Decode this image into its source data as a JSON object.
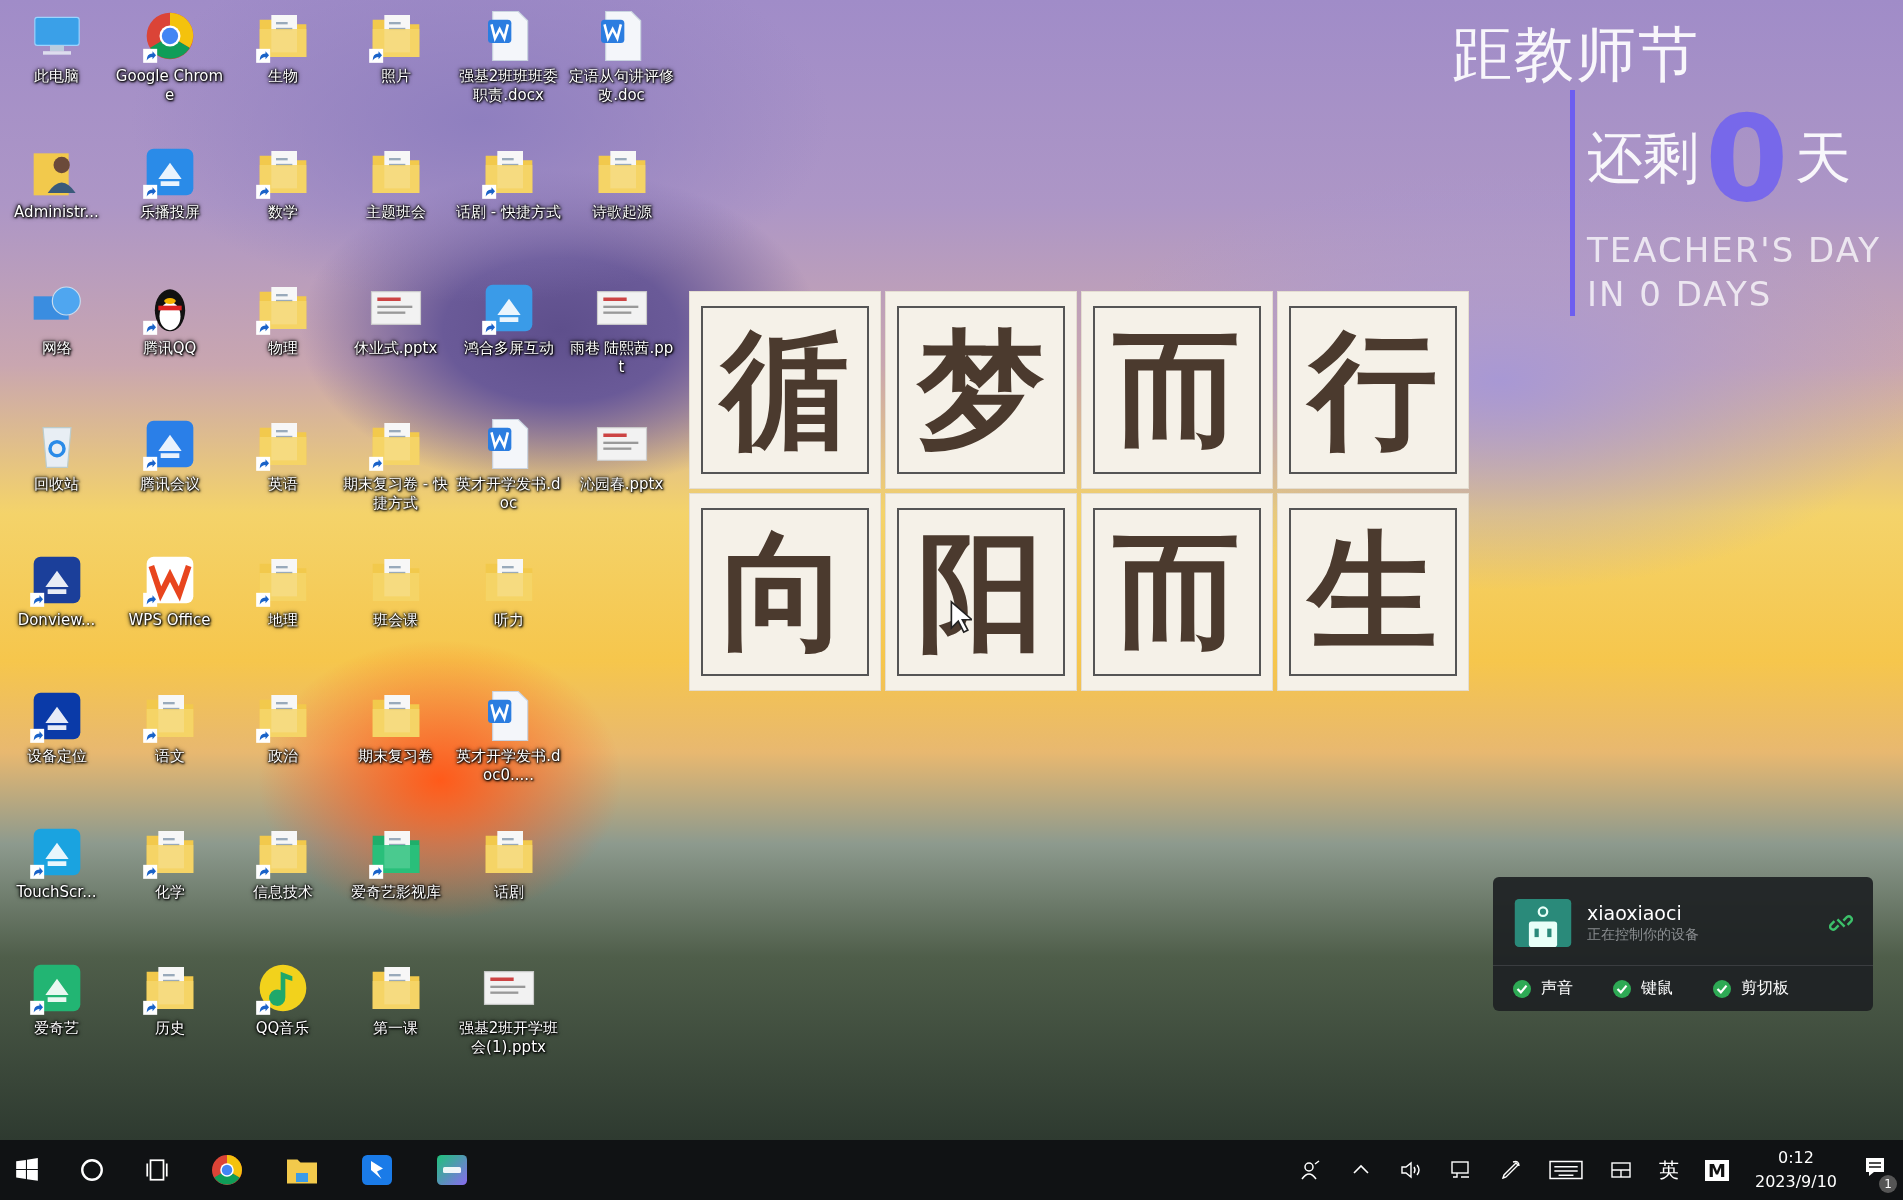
{
  "desktop_icons": [
    {
      "label": "此电脑",
      "kind": "pc",
      "shortcut": false
    },
    {
      "label": "Administr...",
      "kind": "user",
      "shortcut": false
    },
    {
      "label": "网络",
      "kind": "network",
      "shortcut": false
    },
    {
      "label": "回收站",
      "kind": "recycle",
      "shortcut": false
    },
    {
      "label": "Donview...",
      "kind": "pen",
      "shortcut": true
    },
    {
      "label": "设备定位",
      "kind": "locate",
      "shortcut": true
    },
    {
      "label": "TouchScr...",
      "kind": "touch",
      "shortcut": true
    },
    {
      "label": "爱奇艺",
      "kind": "iqiyi",
      "shortcut": true
    },
    {
      "label": "Google Chrome",
      "kind": "chrome",
      "shortcut": true
    },
    {
      "label": "乐播投屏",
      "kind": "cast",
      "shortcut": true
    },
    {
      "label": "腾讯QQ",
      "kind": "qq",
      "shortcut": true
    },
    {
      "label": "腾讯会议",
      "kind": "meeting",
      "shortcut": true
    },
    {
      "label": "WPS Office",
      "kind": "wps",
      "shortcut": true
    },
    {
      "label": "语文",
      "kind": "folder",
      "shortcut": true
    },
    {
      "label": "化学",
      "kind": "folder",
      "shortcut": true
    },
    {
      "label": "历史",
      "kind": "folder",
      "shortcut": true
    },
    {
      "label": "生物",
      "kind": "folder",
      "shortcut": true
    },
    {
      "label": "数学",
      "kind": "folder",
      "shortcut": true
    },
    {
      "label": "物理",
      "kind": "folder",
      "shortcut": true
    },
    {
      "label": "英语",
      "kind": "folder",
      "shortcut": true
    },
    {
      "label": "地理",
      "kind": "folder",
      "shortcut": true
    },
    {
      "label": "政治",
      "kind": "folder",
      "shortcut": true
    },
    {
      "label": "信息技术",
      "kind": "folder",
      "shortcut": true
    },
    {
      "label": "QQ音乐",
      "kind": "music",
      "shortcut": true
    },
    {
      "label": "照片",
      "kind": "folder",
      "shortcut": true
    },
    {
      "label": "主题班会",
      "kind": "folder",
      "shortcut": false
    },
    {
      "label": "休业式.pptx",
      "kind": "ppt",
      "shortcut": false
    },
    {
      "label": "期末复习卷 - 快捷方式",
      "kind": "folder",
      "shortcut": true
    },
    {
      "label": "班会课",
      "kind": "folder",
      "shortcut": false
    },
    {
      "label": "期末复习卷",
      "kind": "folder",
      "shortcut": false
    },
    {
      "label": "爱奇艺影视库",
      "kind": "iqiyifolder",
      "shortcut": true
    },
    {
      "label": "第一课",
      "kind": "folder",
      "shortcut": false
    },
    {
      "label": "强基2班班班委职责.docx",
      "kind": "word",
      "shortcut": false
    },
    {
      "label": "话剧 - 快捷方式",
      "kind": "folder",
      "shortcut": true
    },
    {
      "label": "鸿合多屏互动",
      "kind": "screens",
      "shortcut": true
    },
    {
      "label": "英才开学发书.doc",
      "kind": "word",
      "shortcut": false
    },
    {
      "label": "听力",
      "kind": "folder",
      "shortcut": false
    },
    {
      "label": "英才开学发书.doc0.....",
      "kind": "word",
      "shortcut": false
    },
    {
      "label": "话剧",
      "kind": "folder",
      "shortcut": false
    },
    {
      "label": "强基2班开学班会(1).pptx",
      "kind": "ppt",
      "shortcut": false
    },
    {
      "label": "定语从句讲评修改.doc",
      "kind": "word",
      "shortcut": false
    },
    {
      "label": "诗歌起源",
      "kind": "folder",
      "shortcut": false
    },
    {
      "label": "雨巷 陆熙茜.ppt",
      "kind": "ppt",
      "shortcut": false
    },
    {
      "label": "沁园春.pptx",
      "kind": "ppt",
      "shortcut": false
    }
  ],
  "poster": {
    "lines": [
      "循梦而行",
      "向阳而生"
    ]
  },
  "countdown": {
    "line_1": "距教师节",
    "line_2": "还剩",
    "number": "0",
    "unit": "天",
    "english_1": "TEACHER'S DAY",
    "english_2": "IN 0 DAYS"
  },
  "remote_control": {
    "user": "xiaoxiaoci",
    "status": "正在控制你的设备",
    "permissions": [
      {
        "label": "声音",
        "checked": true
      },
      {
        "label": "键鼠",
        "checked": true
      },
      {
        "label": "剪切板",
        "checked": true
      }
    ]
  },
  "taskbar": {
    "ime": "英",
    "ime_mode": "M",
    "time": "0:12",
    "date": "2023/9/10",
    "notification_count": "1"
  }
}
